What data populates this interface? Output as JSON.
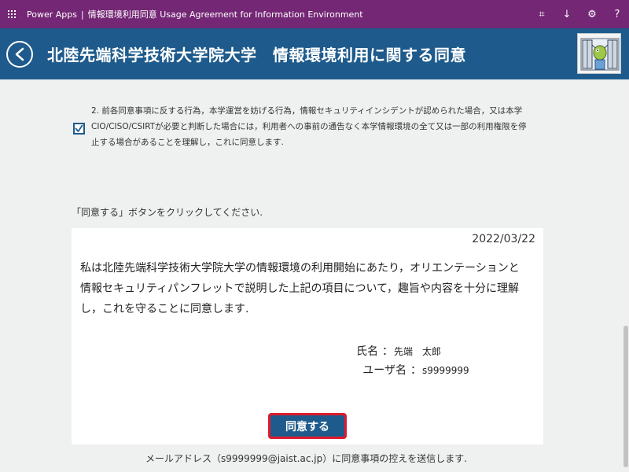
{
  "app": {
    "name": "Power Apps",
    "separator": "|",
    "title": "情報環境利用同意 Usage Agreement for Information Environment"
  },
  "topbar_icons": [
    "fit-screen-icon",
    "download-icon",
    "settings-icon",
    "help-icon"
  ],
  "topbar_glyphs": {
    "fit": "⌗",
    "download": "↓",
    "settings": "⚙",
    "help": "?"
  },
  "header": {
    "title": "北陸先端科学技術大学院大学　情報環境利用に関する同意",
    "background": "#1e5b8c"
  },
  "agreement": {
    "checked": true,
    "line1": "2. 前各同意事項に反する行為，本学運営を妨げる行為，情報セキュリティインシデントが認められた場合，又は本学",
    "line2": "CIO/CISO/CSIRTが必要と判断した場合には，利用者への事前の通告なく本学情報環境の全て又は一部の利用権限を停",
    "line3": "止する場合があることを理解し，これに同意します."
  },
  "instruction": "「同意する」ボタンをクリックしてください.",
  "card": {
    "date": "2022/03/22",
    "body_line1": "私は北陸先端科学技術大学院大学の情報環境の利用開始にあたり，オリエンテーションと",
    "body_line2": "情報セキュリティパンフレットで説明した上記の項目について，趣旨や内容を十分に理解",
    "body_line3": "し，これを守ることに同意します.",
    "name_label": "氏名",
    "name_colon": "：",
    "name_value": "先端　太郎",
    "user_label": "ユーザ名",
    "user_colon": "：",
    "user_value": "s9999999",
    "button_label": "同意する"
  },
  "footer_note": "メールアドレス（s9999999@jaist.ac.jp）に同意事項の控えを送信します.",
  "colors": {
    "topbar": "#742774",
    "header": "#1e5b8c",
    "button": "#1e5b8c",
    "button_border": "#e01a2c",
    "page_background": "#eef1ef"
  }
}
